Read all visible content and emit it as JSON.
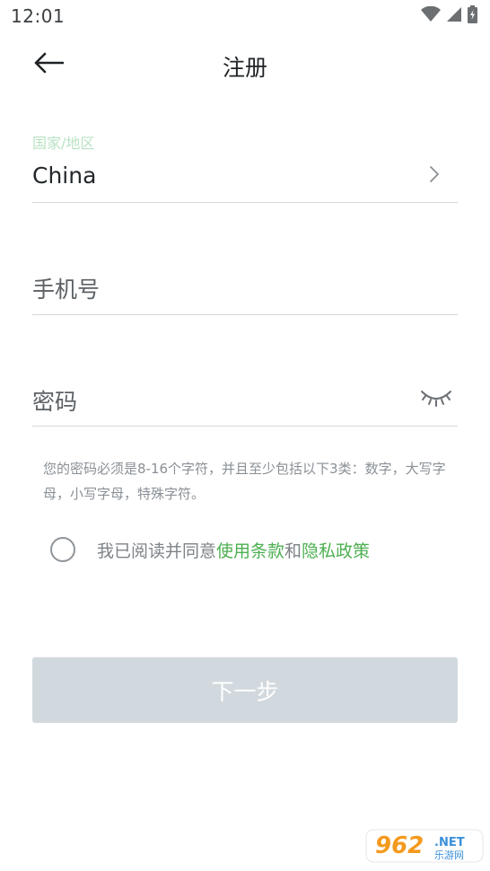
{
  "status_bar": {
    "time": "12:01"
  },
  "header": {
    "title": "注册",
    "back_icon": "arrow-left-icon"
  },
  "form": {
    "country": {
      "label": "国家/地区",
      "value": "China",
      "trailing_icon": "chevron-right-icon"
    },
    "phone": {
      "placeholder": "手机号"
    },
    "password": {
      "placeholder": "密码",
      "trailing_icon": "eye-closed-icon"
    },
    "password_hint": "您的密码必须是8-16个字符，并且至少包括以下3类：数字，大写字母，小写字母，特殊字符。"
  },
  "agreement": {
    "prefix": "我已阅读并同意",
    "terms_link": "使用条款",
    "conjunction": "和",
    "privacy_link": "隐私政策",
    "checked": false
  },
  "next_button": {
    "label": "下一步",
    "enabled": false
  },
  "watermark": {
    "text": "962.NET 乐游网"
  },
  "colors": {
    "accent": "#4caf50",
    "label_green": "#b9e2c3",
    "button_disabled_bg": "#d1d9de",
    "divider": "#d5d7d9"
  }
}
